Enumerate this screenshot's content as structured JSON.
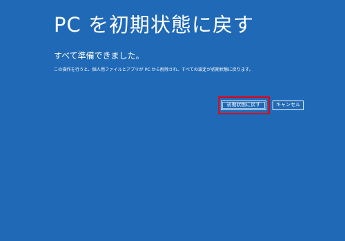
{
  "screen": {
    "title": "PC を初期状態に戻す",
    "subtitle": "すべて準備できました。",
    "description": "この操作を行うと、個人用ファイルとアプリが PC から削除され、すべての設定が初期状態に戻ります。"
  },
  "buttons": {
    "reset_label": "初期状態に戻す",
    "cancel_label": "キャンセル"
  },
  "colors": {
    "background": "#1f69b6",
    "text": "#ffffff",
    "highlight_frame": "#e60012"
  }
}
